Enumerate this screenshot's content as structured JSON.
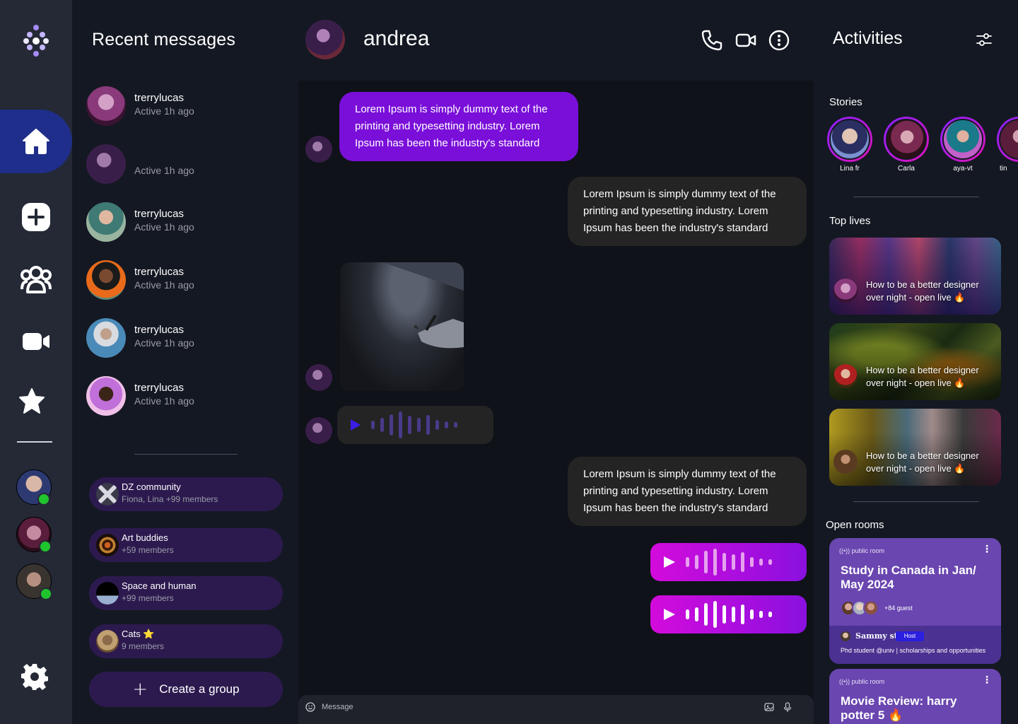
{
  "nav": {
    "items": [
      "home",
      "add",
      "community",
      "video",
      "favorites",
      "settings"
    ],
    "active": "home",
    "online_friends": 3
  },
  "recent": {
    "title": "Recent messages",
    "contacts": [
      {
        "name": "trerrylucas",
        "status": "Active 1h ago"
      },
      {
        "name": "",
        "status": "Active 1h ago"
      },
      {
        "name": "trerrylucas",
        "status": "Active 1h ago"
      },
      {
        "name": "trerrylucas",
        "status": "Active 1h ago"
      },
      {
        "name": "trerrylucas",
        "status": "Active 1h ago"
      },
      {
        "name": "trerrylucas",
        "status": "Active 1h ago"
      }
    ],
    "groups": [
      {
        "name": "DZ community",
        "members": "Fiona, Lina +99 members"
      },
      {
        "name": "Art buddies",
        "members": "+59 members"
      },
      {
        "name": "Space and human",
        "members": "+99 members"
      },
      {
        "name": "Cats ⭐",
        "members": "9 members"
      }
    ],
    "create_label": "Create a group",
    "create_icon": "+"
  },
  "chat": {
    "contact_name": "andrea",
    "messages": [
      {
        "dir": "in",
        "text": "Lorem Ipsum is simply dummy text of the printing and typesetting industry. Lorem Ipsum has been the industry's standard"
      },
      {
        "dir": "out",
        "text": "Lorem Ipsum is simply dummy text of the printing and typesetting industry. Lorem Ipsum has been the industry's standard"
      },
      {
        "dir": "out",
        "text": "Lorem Ipsum is simply dummy text of the printing and typesetting industry. Lorem Ipsum has been the industry's standard"
      }
    ],
    "composer_placeholder": "Message"
  },
  "activities": {
    "title": "Activities",
    "stories_label": "Stories",
    "stories": [
      "Lina fr",
      "Carla",
      "aya-vt",
      "tin"
    ],
    "top_lives_label": "Top lives",
    "lives": [
      {
        "line1": "How to be a better designer",
        "line2": "over night -  open live 🔥"
      },
      {
        "line1": "How to be a better designer",
        "line2": "over night -  open live 🔥"
      },
      {
        "line1": "How to be a better designer",
        "line2": "over night -  open live 🔥"
      }
    ],
    "open_rooms_label": "Open rooms",
    "rooms": [
      {
        "type": "public room",
        "title": "Study in Canada in Jan/ May 2024",
        "guests": "+84 guest",
        "host": "Sammy st",
        "host_badge": "Host",
        "bio": "Phd student @univ | scholarships and opportunities"
      },
      {
        "type": "public room",
        "title": "Movie Review: harry potter 5 🔥"
      }
    ]
  },
  "colors": {
    "accent": "#7a0fd9",
    "active_nav": "#1f2e8a",
    "online": "#20c42e",
    "voice_gradient_start": "#d30bdc",
    "voice_gradient_end": "#8a10df",
    "room": "#6a46b0"
  }
}
